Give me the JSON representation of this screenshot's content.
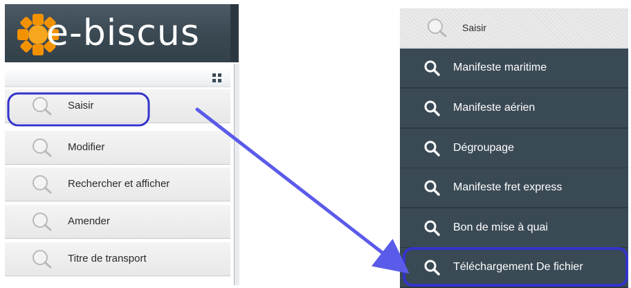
{
  "logo": {
    "text_e": "e",
    "text_rest": "-biscus"
  },
  "left_menu": {
    "items": [
      {
        "label": "Saisir"
      },
      {
        "label": "Modifier"
      },
      {
        "label": "Rechercher et afficher"
      },
      {
        "label": "Amender"
      },
      {
        "label": "Titre de transport"
      }
    ]
  },
  "right_menu": {
    "header": {
      "label": "Saisir"
    },
    "items": [
      {
        "label": "Manifeste maritime"
      },
      {
        "label": "Manifeste aérien"
      },
      {
        "label": "Dégroupage"
      },
      {
        "label": "Manifeste fret express"
      },
      {
        "label": "Bon de mise à quai"
      },
      {
        "label": "Téléchargement De fichier"
      }
    ]
  },
  "colors": {
    "logo_bar": "#3a4852",
    "flower_orange": "#f39200",
    "submenu_bg": "#3a4a55",
    "highlight": "#3333cc",
    "arrow": "#5b5bea"
  },
  "icons": {
    "search": "search-icon",
    "grid": "grid-icon"
  }
}
